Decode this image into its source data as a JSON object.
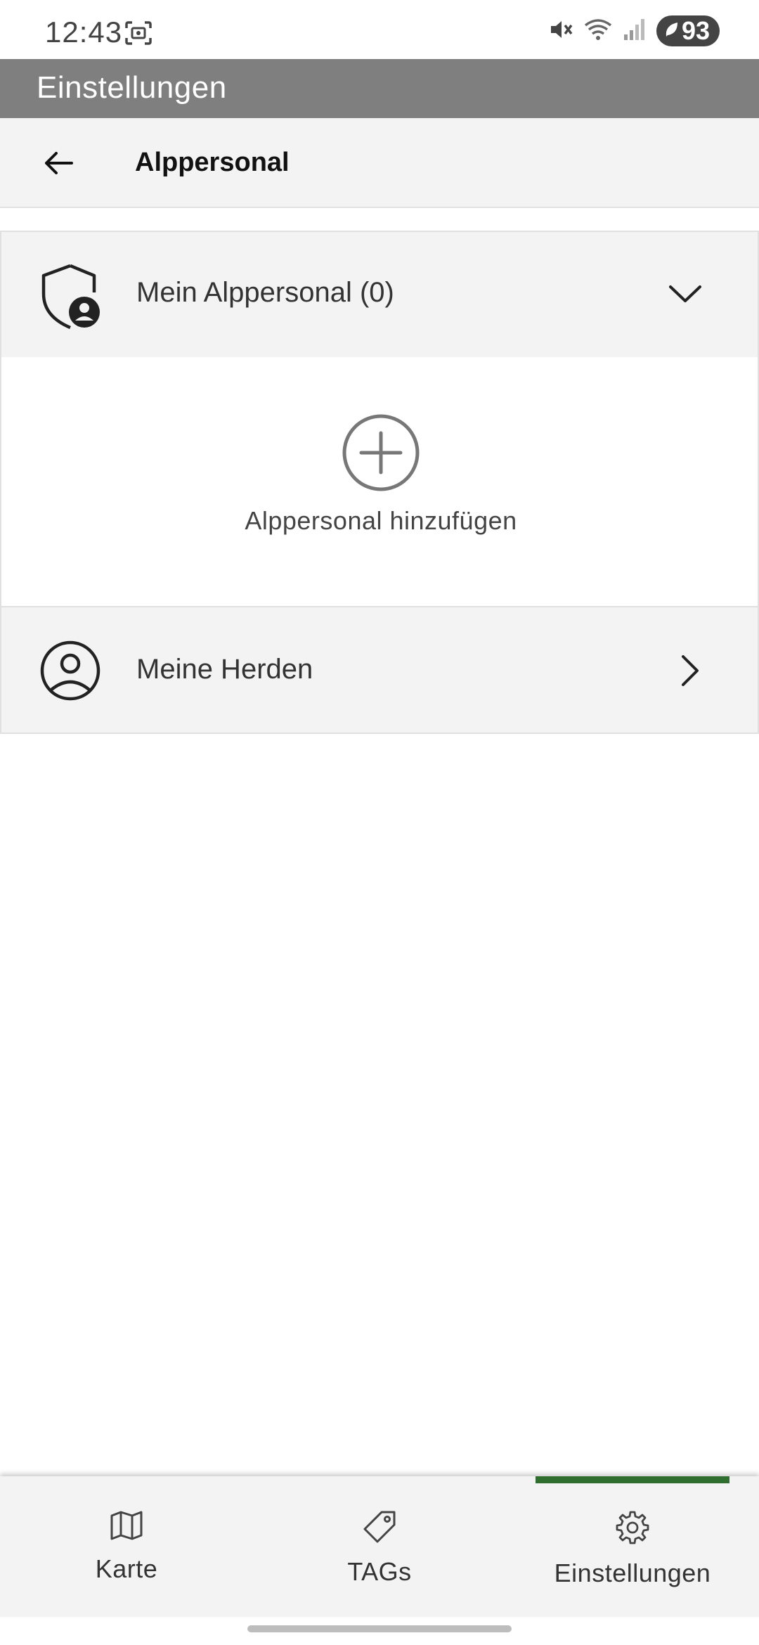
{
  "status_bar": {
    "time": "12:43",
    "battery": "93"
  },
  "app_bar": {
    "title": "Einstellungen"
  },
  "page_header": {
    "title": "Alppersonal",
    "back_icon": "arrow-left-icon"
  },
  "accordion": {
    "label": "Mein Alppersonal (0)",
    "icon": "shield-user-icon",
    "chevron": "chevron-down-icon",
    "expanded": true,
    "add_label": "Alppersonal hinzufügen"
  },
  "herds_row": {
    "label": "Meine Herden",
    "icon": "user-circle-icon",
    "chevron": "chevron-right-icon"
  },
  "bottom_nav": {
    "items": [
      {
        "label": "Karte",
        "icon": "map-icon",
        "active": false
      },
      {
        "label": "TAGs",
        "icon": "tag-icon",
        "active": false
      },
      {
        "label": "Einstellungen",
        "icon": "gear-icon",
        "active": true
      }
    ],
    "active_color": "#2f6e2f"
  },
  "colors": {
    "app_bar": "#7f7f7f",
    "surface": "#f3f3f3",
    "accent": "#2f6e2f"
  }
}
